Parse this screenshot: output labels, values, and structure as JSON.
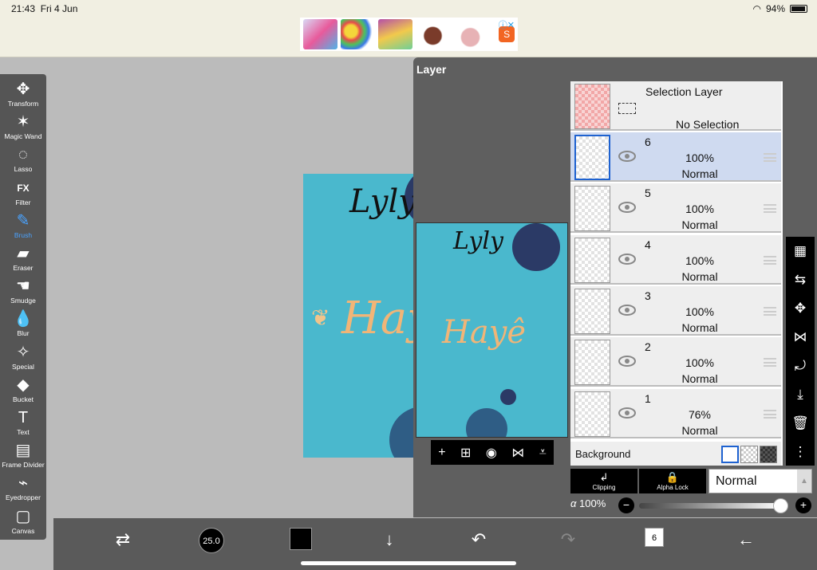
{
  "status": {
    "time": "21:43",
    "date": "Fri 4 Jun",
    "battery": "94%"
  },
  "ad": {
    "store_icon": "shopee-bag-icon",
    "adchoices": "ⓘ✕"
  },
  "tools": [
    {
      "name": "transform",
      "label": "Transform",
      "icon": "✥"
    },
    {
      "name": "magic-wand",
      "label": "Magic Wand",
      "icon": "✶"
    },
    {
      "name": "lasso",
      "label": "Lasso",
      "icon": "◌"
    },
    {
      "name": "filter",
      "label": "Filter",
      "icon": "FX"
    },
    {
      "name": "brush",
      "label": "Brush",
      "icon": "✎",
      "active": true
    },
    {
      "name": "eraser",
      "label": "Eraser",
      "icon": "▰"
    },
    {
      "name": "smudge",
      "label": "Smudge",
      "icon": "☚"
    },
    {
      "name": "blur",
      "label": "Blur",
      "icon": "💧"
    },
    {
      "name": "special",
      "label": "Special",
      "icon": "✧"
    },
    {
      "name": "bucket",
      "label": "Bucket",
      "icon": "◆"
    },
    {
      "name": "text",
      "label": "Text",
      "icon": "T"
    },
    {
      "name": "frame-divider",
      "label": "Frame Divider",
      "icon": "▤"
    },
    {
      "name": "eyedropper",
      "label": "Eyedropper",
      "icon": "⌁"
    },
    {
      "name": "canvas",
      "label": "Canvas",
      "icon": "▢"
    }
  ],
  "artwork": {
    "signature_text": "Lyly",
    "title_text": "Hayê"
  },
  "layer_panel": {
    "title": "Layer",
    "selection_layer": {
      "title": "Selection Layer",
      "status": "No Selection"
    },
    "layers": [
      {
        "num": "6",
        "opacity": "100%",
        "mode": "Normal",
        "selected": true
      },
      {
        "num": "5",
        "opacity": "100%",
        "mode": "Normal"
      },
      {
        "num": "4",
        "opacity": "100%",
        "mode": "Normal"
      },
      {
        "num": "3",
        "opacity": "100%",
        "mode": "Normal"
      },
      {
        "num": "2",
        "opacity": "100%",
        "mode": "Normal"
      },
      {
        "num": "1",
        "opacity": "76%",
        "mode": "Normal"
      }
    ],
    "background_label": "Background",
    "clipping_label": "Clipping",
    "alpha_lock_label": "Alpha Lock",
    "blend_mode": "Normal",
    "opacity_symbol": "α",
    "opacity_value": "100%",
    "opacity_fraction": 1.0
  },
  "bottom": {
    "brush_size": "25.0",
    "layer_count": "6"
  },
  "colors": {
    "canvas_teal": "#4ab8cd",
    "accent_blue": "#1e62d0",
    "toolbar_gray": "#555555"
  }
}
